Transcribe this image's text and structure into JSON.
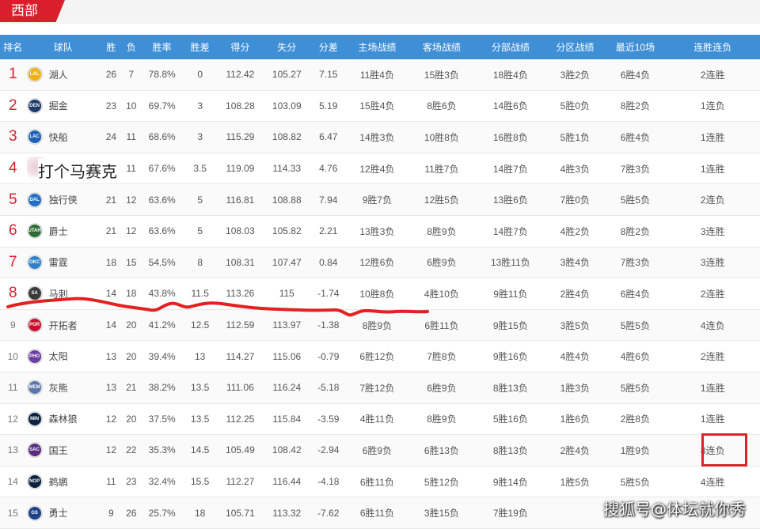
{
  "conference_tab": "西部",
  "headers": {
    "rank": "排名",
    "team": "球队",
    "wins": "胜",
    "losses": "负",
    "pct": "胜率",
    "gb": "胜差",
    "pf": "得分",
    "pa": "失分",
    "diff": "分差",
    "home": "主场战绩",
    "away": "客场战绩",
    "division": "分部战绩",
    "conference": "分区战绩",
    "last10": "最近10场",
    "streak": "连胜连负"
  },
  "rows": [
    {
      "rank": "1",
      "team": "湖人",
      "logo": "LAL",
      "color": "#f0b21a",
      "w": "26",
      "l": "7",
      "pct": "78.8%",
      "gb": "0",
      "pf": "112.42",
      "pa": "105.27",
      "diff": "7.15",
      "home": "11胜4负",
      "away": "15胜3负",
      "div": "18胜4负",
      "conf": "3胜2负",
      "l10": "6胜4负",
      "strk": "2连胜"
    },
    {
      "rank": "2",
      "team": "掘金",
      "logo": "DEN",
      "color": "#1d3c6e",
      "w": "23",
      "l": "10",
      "pct": "69.7%",
      "gb": "3",
      "pf": "108.28",
      "pa": "103.09",
      "diff": "5.19",
      "home": "15胜4负",
      "away": "8胜6负",
      "div": "14胜6负",
      "conf": "5胜0负",
      "l10": "8胜2负",
      "strk": "1连负"
    },
    {
      "rank": "3",
      "team": "快船",
      "logo": "LAC",
      "color": "#1d62b8",
      "w": "24",
      "l": "11",
      "pct": "68.6%",
      "gb": "3",
      "pf": "115.29",
      "pa": "108.82",
      "diff": "6.47",
      "home": "14胜3负",
      "away": "10胜8负",
      "div": "16胜8负",
      "conf": "5胜1负",
      "l10": "6胜4负",
      "strk": "1连胜"
    },
    {
      "rank": "4",
      "team": "",
      "logo": "",
      "color": "#ffffff",
      "w": "",
      "l": "11",
      "pct": "67.6%",
      "gb": "3.5",
      "pf": "119.09",
      "pa": "114.33",
      "diff": "4.76",
      "home": "12胜4负",
      "away": "11胜7负",
      "div": "14胜7负",
      "conf": "4胜3负",
      "l10": "7胜3负",
      "strk": "1连胜"
    },
    {
      "rank": "5",
      "team": "独行侠",
      "logo": "DAL",
      "color": "#1f6fc4",
      "w": "21",
      "l": "12",
      "pct": "63.6%",
      "gb": "5",
      "pf": "116.81",
      "pa": "108.88",
      "diff": "7.94",
      "home": "9胜7负",
      "away": "12胜5负",
      "div": "13胜6负",
      "conf": "7胜0负",
      "l10": "5胜5负",
      "strk": "2连负"
    },
    {
      "rank": "6",
      "team": "爵士",
      "logo": "UTAH",
      "color": "#2d6b35",
      "w": "21",
      "l": "12",
      "pct": "63.6%",
      "gb": "5",
      "pf": "108.03",
      "pa": "105.82",
      "diff": "2.21",
      "home": "13胜3负",
      "away": "8胜9负",
      "div": "14胜7负",
      "conf": "4胜2负",
      "l10": "8胜2负",
      "strk": "3连胜"
    },
    {
      "rank": "7",
      "team": "雷霆",
      "logo": "OKC",
      "color": "#2f82c8",
      "w": "18",
      "l": "15",
      "pct": "54.5%",
      "gb": "8",
      "pf": "108.31",
      "pa": "107.47",
      "diff": "0.84",
      "home": "12胜6负",
      "away": "6胜9负",
      "div": "13胜11负",
      "conf": "3胜4负",
      "l10": "7胜3负",
      "strk": "3连胜"
    },
    {
      "rank": "8",
      "team": "马刺",
      "logo": "SA",
      "color": "#3a3a3a",
      "w": "14",
      "l": "18",
      "pct": "43.8%",
      "gb": "11.5",
      "pf": "113.26",
      "pa": "115",
      "diff": "-1.74",
      "home": "10胜8负",
      "away": "4胜10负",
      "div": "9胜11负",
      "conf": "2胜4负",
      "l10": "6胜4负",
      "strk": "2连胜"
    },
    {
      "rank": "9",
      "team": "开拓者",
      "logo": "POR",
      "color": "#c8102e",
      "w": "14",
      "l": "20",
      "pct": "41.2%",
      "gb": "12.5",
      "pf": "112.59",
      "pa": "113.97",
      "diff": "-1.38",
      "home": "8胜9负",
      "away": "6胜11负",
      "div": "9胜15负",
      "conf": "3胜5负",
      "l10": "5胜5负",
      "strk": "4连负"
    },
    {
      "rank": "10",
      "team": "太阳",
      "logo": "PHO",
      "color": "#6b3fa0",
      "w": "13",
      "l": "20",
      "pct": "39.4%",
      "gb": "13",
      "pf": "114.27",
      "pa": "115.06",
      "diff": "-0.79",
      "home": "6胜12负",
      "away": "7胜8负",
      "div": "9胜16负",
      "conf": "4胜4负",
      "l10": "4胜6负",
      "strk": "2连胜"
    },
    {
      "rank": "11",
      "team": "灰熊",
      "logo": "MEM",
      "color": "#5d76a9",
      "w": "13",
      "l": "21",
      "pct": "38.2%",
      "gb": "13.5",
      "pf": "111.06",
      "pa": "116.24",
      "diff": "-5.18",
      "home": "7胜12负",
      "away": "6胜9负",
      "div": "8胜13负",
      "conf": "1胜3负",
      "l10": "5胜5负",
      "strk": "1连胜"
    },
    {
      "rank": "12",
      "team": "森林狼",
      "logo": "MIN",
      "color": "#0c2340",
      "w": "12",
      "l": "20",
      "pct": "37.5%",
      "gb": "13.5",
      "pf": "112.25",
      "pa": "115.84",
      "diff": "-3.59",
      "home": "4胜11负",
      "away": "8胜9负",
      "div": "5胜16负",
      "conf": "1胜6负",
      "l10": "2胜8负",
      "strk": "1连胜"
    },
    {
      "rank": "13",
      "team": "国王",
      "logo": "SAC",
      "color": "#5a2d81",
      "w": "12",
      "l": "22",
      "pct": "35.3%",
      "gb": "14.5",
      "pf": "105.49",
      "pa": "108.42",
      "diff": "-2.94",
      "home": "6胜9负",
      "away": "6胜13负",
      "div": "8胜13负",
      "conf": "2胜4负",
      "l10": "1胜9负",
      "strk": "8连负"
    },
    {
      "rank": "14",
      "team": "鹈鹕",
      "logo": "NOP",
      "color": "#0c2340",
      "w": "11",
      "l": "23",
      "pct": "32.4%",
      "gb": "15.5",
      "pf": "112.27",
      "pa": "116.44",
      "diff": "-4.18",
      "home": "6胜11负",
      "away": "5胜12负",
      "div": "9胜14负",
      "conf": "1胜5负",
      "l10": "5胜5负",
      "strk": "4连胜"
    },
    {
      "rank": "15",
      "team": "勇士",
      "logo": "GS",
      "color": "#1d428a",
      "w": "9",
      "l": "26",
      "pct": "25.7%",
      "gb": "18",
      "pf": "105.71",
      "pa": "113.32",
      "diff": "-7.62",
      "home": "6胜11负",
      "away": "3胜15负",
      "div": "7胜19负",
      "conf": "",
      "l10": "",
      "strk": ""
    }
  ],
  "annotation_text": "打个马赛克",
  "watermark": "搜狐号@体坛就你秀"
}
